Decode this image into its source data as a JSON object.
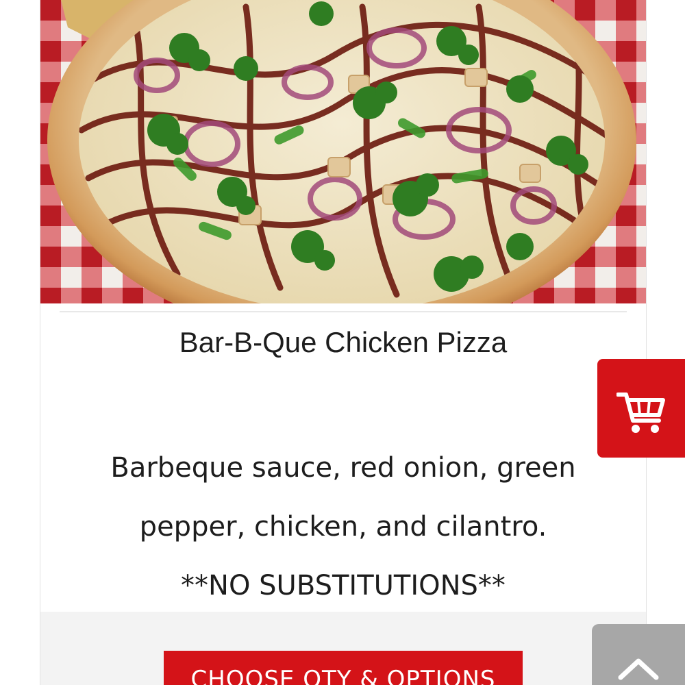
{
  "product": {
    "title": "Bar-B-Que Chicken Pizza",
    "description_lines": [
      "Barbeque sauce, red onion, green",
      "pepper, chicken, and cilantro."
    ],
    "note": "**NO SUBSTITUTIONS**",
    "image_subject": "bbq-chicken-pizza-photo"
  },
  "actions": {
    "choose_label": "CHOOSE QTY & OPTIONS",
    "cart_icon": "shopping-cart-icon",
    "back_to_top_icon": "chevron-up-icon"
  },
  "colors": {
    "accent": "#d41318",
    "scroll_button": "#a7a7a7",
    "footer_bg": "#f3f3f3",
    "text": "#1d1d1d"
  }
}
